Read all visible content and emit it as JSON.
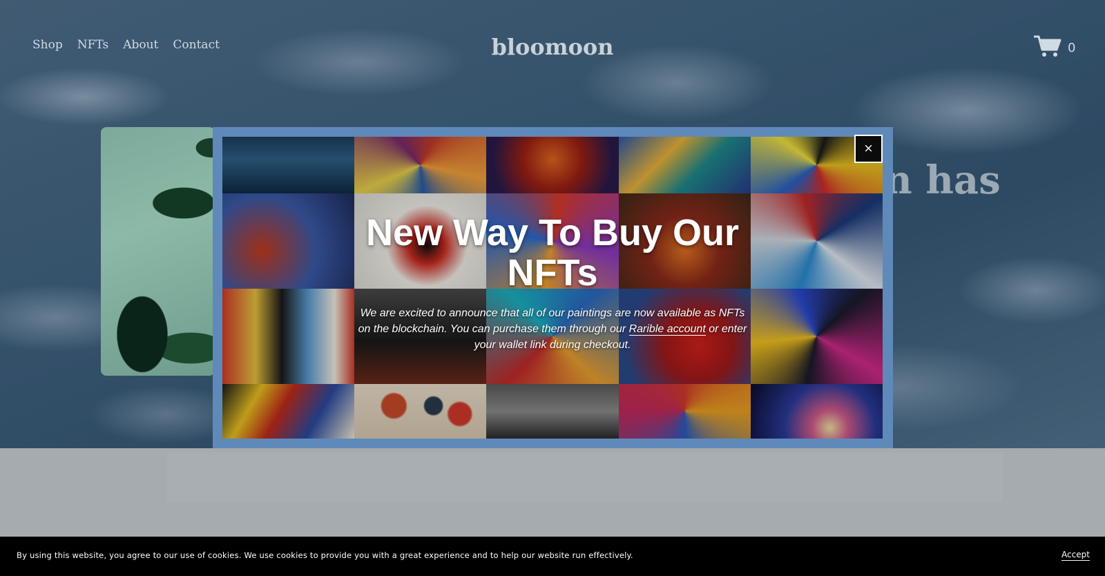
{
  "header": {
    "nav": [
      {
        "label": "Shop"
      },
      {
        "label": "NFTs"
      },
      {
        "label": "About"
      },
      {
        "label": "Contact"
      }
    ],
    "logo": "bloomoon",
    "cart_count": "0",
    "cart_icon": "cart-icon"
  },
  "hero": {
    "headline_fragment": "n has"
  },
  "modal": {
    "title": "New Way To Buy Our NFTs",
    "text_before_link": "We are excited to announce that all of our paintings are now available as NFTs on the blockchain. You can purchase them through our ",
    "link_text": "Rarible account",
    "text_after_link": " or enter your wallet link during checkout.",
    "close_label": "×",
    "frame_color": "#5f89b9"
  },
  "cookie": {
    "text": "By using this website, you agree to our use of cookies. We use cookies to provide you with a great experience and to help our website run effectively.",
    "accept_label": "Accept"
  }
}
